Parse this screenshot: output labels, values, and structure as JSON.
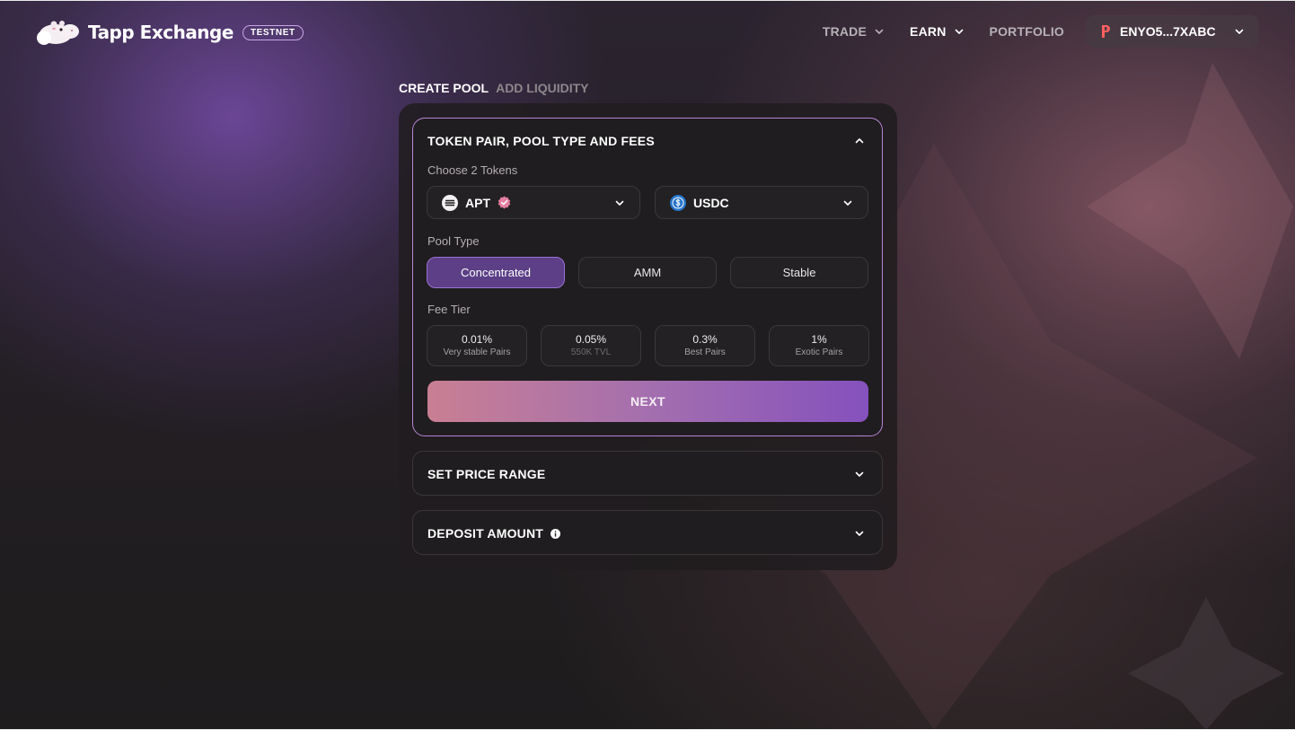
{
  "header": {
    "brand": "Tapp Exchange",
    "badge": "TESTNET",
    "nav": [
      {
        "label": "TRADE",
        "has_dropdown": true
      },
      {
        "label": "EARN",
        "has_dropdown": true
      },
      {
        "label": "PORTFOLIO",
        "has_dropdown": false
      }
    ],
    "wallet": {
      "address": "ENYO5...7XABC",
      "icon": "petra-wallet-icon"
    }
  },
  "tabs": [
    {
      "label": "CREATE POOL",
      "active": true
    },
    {
      "label": "ADD LIQUIDITY",
      "active": false
    }
  ],
  "section1": {
    "title": "TOKEN PAIR, POOL TYPE AND FEES",
    "expanded": true,
    "choose_label": "Choose 2 Tokens",
    "token_a": {
      "symbol": "APT",
      "verified": true,
      "icon": "aptos-icon"
    },
    "token_b": {
      "symbol": "USDC",
      "icon": "usdc-icon"
    },
    "pool_type_label": "Pool Type",
    "pool_types": [
      {
        "label": "Concentrated",
        "selected": true
      },
      {
        "label": "AMM",
        "selected": false
      },
      {
        "label": "Stable",
        "selected": false
      }
    ],
    "fee_tier_label": "Fee Tier",
    "fee_tiers": [
      {
        "value": "0.01%",
        "desc": "Very stable Pairs"
      },
      {
        "value": "0.05%",
        "desc": "550K TVL"
      },
      {
        "value": "0.3%",
        "desc": "Best Pairs"
      },
      {
        "value": "1%",
        "desc": "Exotic Pairs"
      }
    ],
    "next_label": "NEXT"
  },
  "section2": {
    "title": "SET PRICE RANGE",
    "expanded": false
  },
  "section3": {
    "title": "DEPOSIT AMOUNT",
    "expanded": false,
    "has_info": true
  },
  "colors": {
    "accent_purple": "#8551bd",
    "accent_pink": "#c97f93",
    "selected_pool": "#5c3f86",
    "verified_badge": "#e37fa0"
  }
}
